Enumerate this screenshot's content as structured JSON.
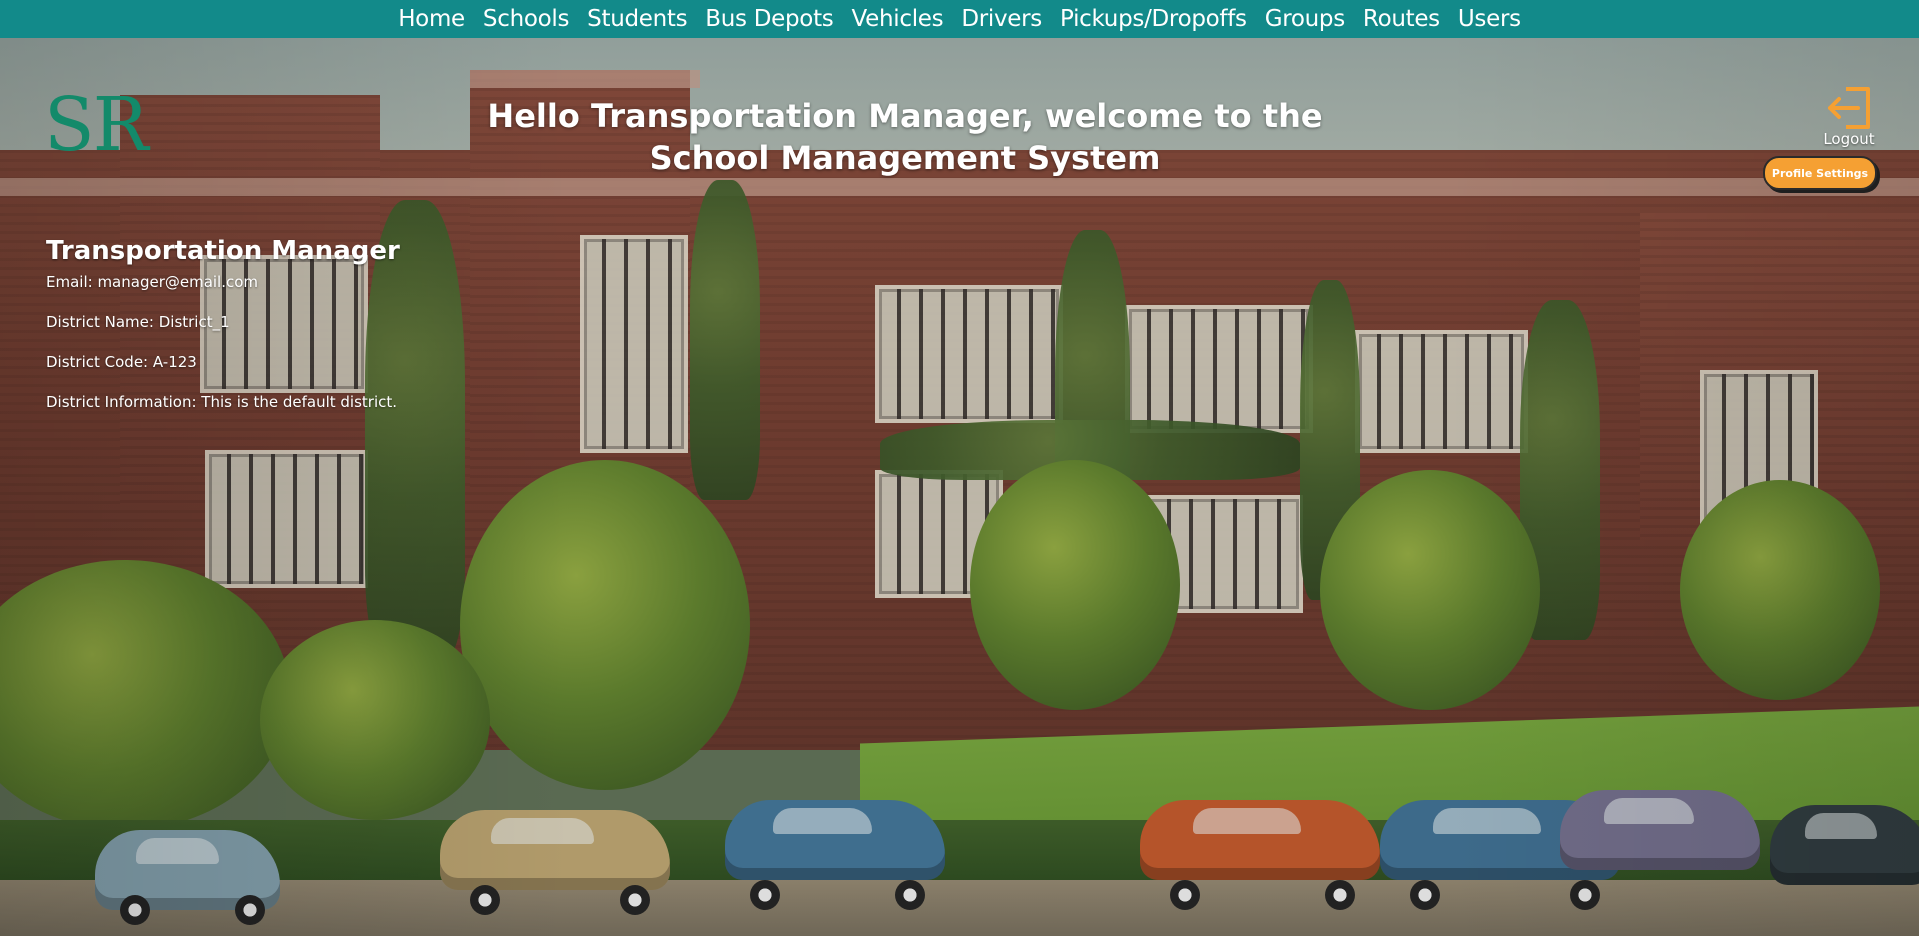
{
  "nav": {
    "items": [
      "Home",
      "Schools",
      "Students",
      "Bus Depots",
      "Vehicles",
      "Drivers",
      "Pickups/Dropoffs",
      "Groups",
      "Routes",
      "Users"
    ]
  },
  "logo": {
    "text": "SR"
  },
  "welcome": {
    "line1": "Hello Transportation Manager, welcome to the",
    "line2": "School Management System"
  },
  "profile": {
    "name": "Transportation Manager",
    "email": "Email: manager@email.com",
    "district_name": "District Name: District_1",
    "district_code": "District Code: A-123",
    "district_info": "District Information: This is the default district."
  },
  "logout": {
    "label": "Logout",
    "icon": "logout-arrow-icon"
  },
  "profile_settings": {
    "label": "Profile Settings"
  },
  "colors": {
    "navbar": "#128a8a",
    "logo": "#138a6a",
    "accent": "#f5a033",
    "text": "#ffffff"
  },
  "background": {
    "icon": "school-building-painting"
  }
}
